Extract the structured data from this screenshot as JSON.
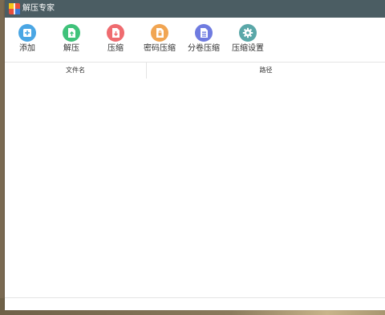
{
  "window": {
    "title": "解压专家"
  },
  "toolbar": {
    "items": [
      {
        "label": "添加",
        "icon": "add-icon",
        "color": "#4aa6e4"
      },
      {
        "label": "解压",
        "icon": "extract-icon",
        "color": "#3fc27a"
      },
      {
        "label": "压缩",
        "icon": "compress-icon",
        "color": "#ef6b6f"
      },
      {
        "label": "密码压缩",
        "icon": "password-compress-icon",
        "color": "#f1a552"
      },
      {
        "label": "分卷压缩",
        "icon": "split-compress-icon",
        "color": "#6f7be0"
      },
      {
        "label": "压缩设置",
        "icon": "settings-gear-icon",
        "color": "#5aa7a8"
      }
    ]
  },
  "table": {
    "columns": [
      "文件名",
      "路径"
    ],
    "rows": []
  },
  "colors": {
    "titlebar": "#4b5d63",
    "window_bg": "#ffffff"
  }
}
